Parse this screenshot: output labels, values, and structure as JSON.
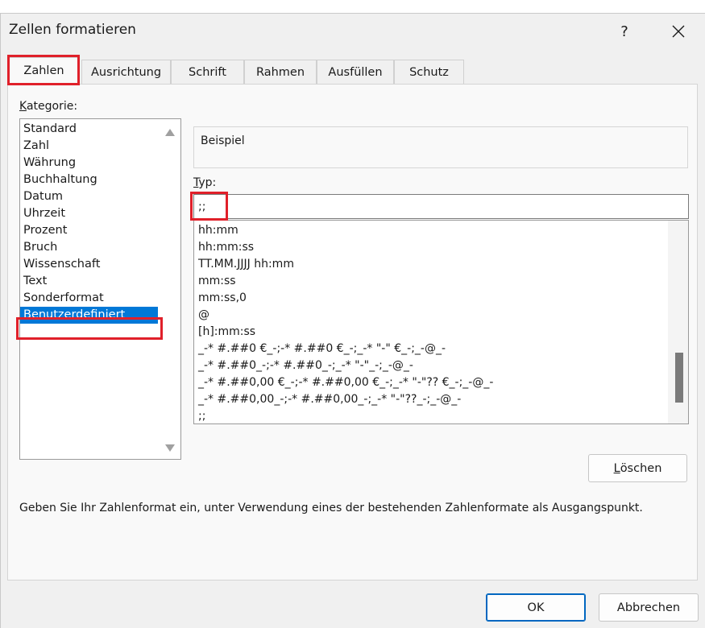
{
  "dialog": {
    "title": "Zellen formatieren",
    "help_label": "?",
    "close_icon": "close-icon"
  },
  "tabs": [
    {
      "label": "Zahlen",
      "active": true
    },
    {
      "label": "Ausrichtung",
      "active": false
    },
    {
      "label": "Schrift",
      "active": false
    },
    {
      "label": "Rahmen",
      "active": false
    },
    {
      "label": "Ausfüllen",
      "active": false
    },
    {
      "label": "Schutz",
      "active": false
    }
  ],
  "category": {
    "label_underlined": "K",
    "label_rest": "ategorie:",
    "items": [
      "Standard",
      "Zahl",
      "Währung",
      "Buchhaltung",
      "Datum",
      "Uhrzeit",
      "Prozent",
      "Bruch",
      "Wissenschaft",
      "Text",
      "Sonderformat",
      "Benutzerdefiniert"
    ],
    "selected": "Benutzerdefiniert"
  },
  "beispiel": {
    "label": "Beispiel"
  },
  "typ": {
    "label_underlined": "T",
    "label_rest": "yp:",
    "value": ";;",
    "items": [
      "hh:mm",
      "hh:mm:ss",
      "TT.MM.JJJJ hh:mm",
      "mm:ss",
      "mm:ss,0",
      "@",
      "[h]:mm:ss",
      "_-* #.##0 €_-;-* #.##0 €_-;_-* \"-\" €_-;_-@_-",
      "_-* #.##0_-;-* #.##0_-;_-* \"-\"_-;_-@_-",
      "_-* #.##0,00 €_-;-* #.##0,00 €_-;_-* \"-\"?? €_-;_-@_-",
      "_-* #.##0,00_-;-* #.##0,00_-;_-* \"-\"??_-;_-@_-",
      ";;"
    ]
  },
  "buttons": {
    "loeschen_underlined": "L",
    "loeschen_rest": "öschen",
    "ok": "OK",
    "cancel": "Abbrechen"
  },
  "description": "Geben Sie Ihr Zahlenformat ein, unter Verwendung eines der bestehenden Zahlenformate als Ausgangspunkt.",
  "colors": {
    "selection": "#0078d7",
    "highlight": "#e0202a",
    "primary_border": "#0067c0"
  }
}
